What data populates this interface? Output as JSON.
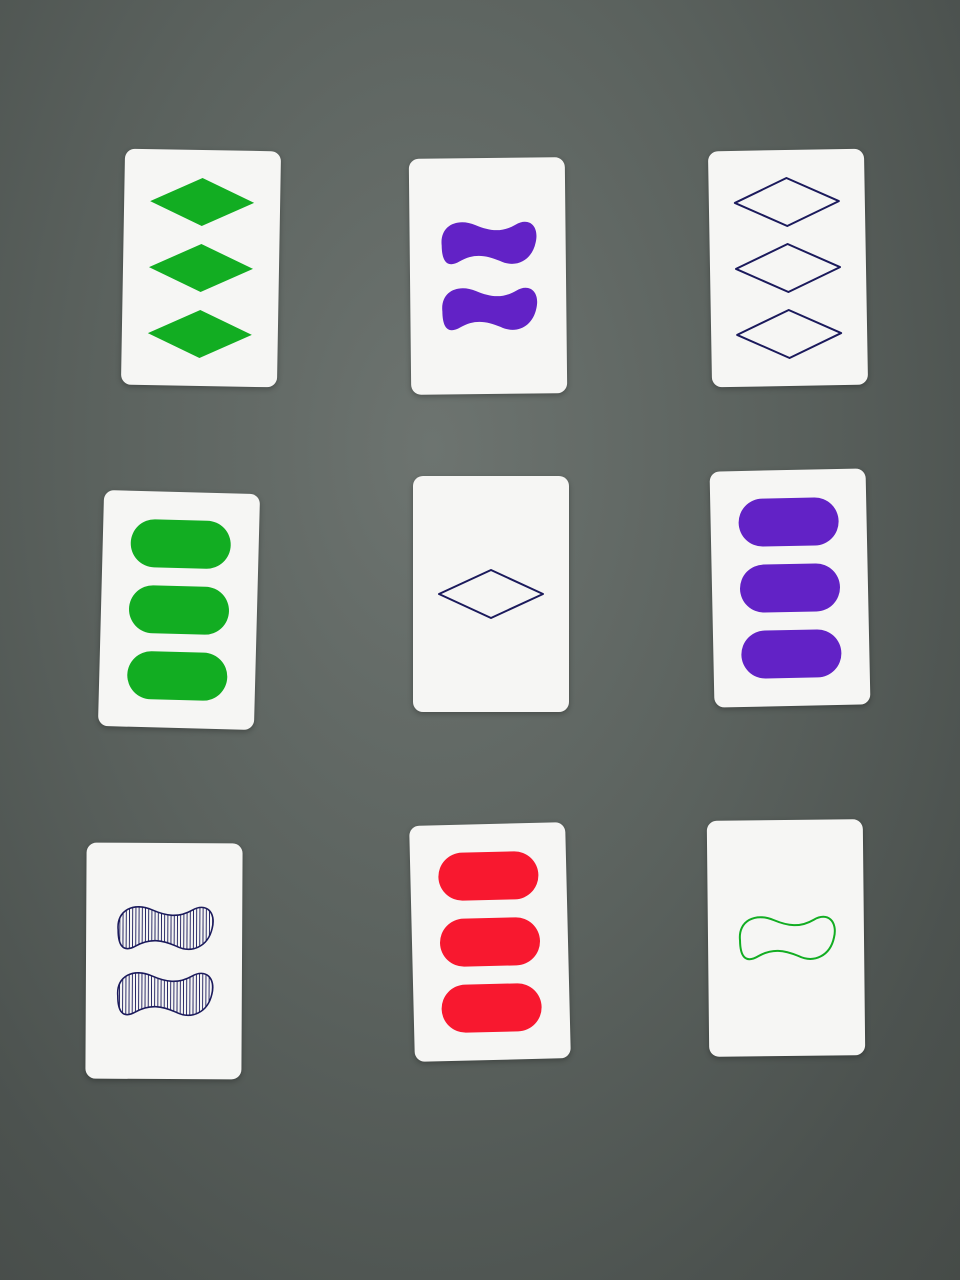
{
  "colors": {
    "green": "#12ad22",
    "purple": "#6222c6",
    "red": "#f8182f",
    "navy": "#1b1a5c",
    "card": "#f6f6f4"
  },
  "cards": [
    {
      "name": "card-r1c1",
      "count": 3,
      "shape": "diamond",
      "fill": "solid",
      "color": "green"
    },
    {
      "name": "card-r1c2",
      "count": 2,
      "shape": "squiggle",
      "fill": "solid",
      "color": "purple"
    },
    {
      "name": "card-r1c3",
      "count": 3,
      "shape": "diamond",
      "fill": "outline",
      "color": "navy"
    },
    {
      "name": "card-r2c1",
      "count": 3,
      "shape": "oval",
      "fill": "solid",
      "color": "green"
    },
    {
      "name": "card-r2c2",
      "count": 1,
      "shape": "diamond",
      "fill": "outline",
      "color": "navy"
    },
    {
      "name": "card-r2c3",
      "count": 3,
      "shape": "oval",
      "fill": "solid",
      "color": "purple"
    },
    {
      "name": "card-r3c1",
      "count": 2,
      "shape": "squiggle",
      "fill": "striped",
      "color": "navy"
    },
    {
      "name": "card-r3c2",
      "count": 3,
      "shape": "oval",
      "fill": "solid",
      "color": "red"
    },
    {
      "name": "card-r3c3",
      "count": 1,
      "shape": "squiggle",
      "fill": "outline",
      "color": "green"
    }
  ]
}
